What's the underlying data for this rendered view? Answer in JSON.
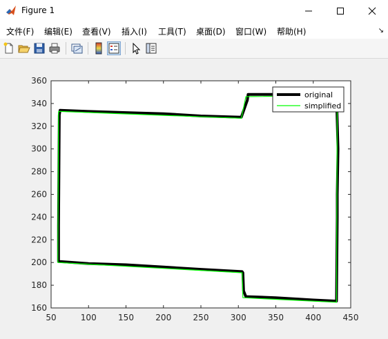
{
  "window": {
    "title": "Figure 1",
    "icons": {
      "app": "matlab-icon",
      "minimize": "minimize-icon",
      "maximize": "maximize-icon",
      "close": "close-icon"
    }
  },
  "menu": {
    "items": [
      "文件(F)",
      "编辑(E)",
      "查看(V)",
      "插入(I)",
      "工具(T)",
      "桌面(D)",
      "窗口(W)",
      "帮助(H)"
    ],
    "overflow_icon": "dock-arrow-icon"
  },
  "toolbar": {
    "buttons": [
      {
        "icon": "new-figure-icon"
      },
      {
        "icon": "open-file-icon"
      },
      {
        "icon": "save-icon"
      },
      {
        "icon": "print-icon"
      },
      {
        "icon": "link-plot-icon"
      },
      {
        "icon": "insert-colorbar-icon"
      },
      {
        "icon": "insert-legend-icon",
        "active": true
      },
      {
        "icon": "edit-plot-icon"
      },
      {
        "icon": "property-editor-icon"
      }
    ]
  },
  "colors": {
    "original": "#000000",
    "simplified": "#00ff00",
    "axes_bg": "#ffffff",
    "figure_bg": "#f0f0f0"
  },
  "chart_data": {
    "type": "line",
    "xlim": [
      50,
      450
    ],
    "ylim": [
      160,
      360
    ],
    "xticks": [
      50,
      100,
      150,
      200,
      250,
      300,
      350,
      400,
      450
    ],
    "yticks": [
      160,
      180,
      200,
      220,
      240,
      260,
      280,
      300,
      320,
      340,
      360
    ],
    "grid": false,
    "legend_position": "top-right",
    "series": [
      {
        "name": "original",
        "color": "#000000",
        "x": [
          61,
          62,
          100,
          150,
          200,
          250,
          300,
          304,
          312,
          313,
          340,
          380,
          431,
          433,
          432,
          432,
          431,
          400,
          350,
          310,
          307,
          306,
          305,
          250,
          200,
          150,
          100,
          60,
          60,
          61
        ],
        "y": [
          330,
          334,
          333,
          332,
          331,
          329,
          328,
          328,
          343,
          348,
          348,
          348,
          347,
          300,
          260,
          240,
          166,
          167,
          169,
          170,
          175,
          191,
          192,
          194,
          196,
          198,
          199,
          201,
          232,
          330
        ]
      },
      {
        "name": "simplified",
        "color": "#00ff00",
        "x": [
          60,
          62,
          304,
          310,
          432,
          431,
          306,
          305,
          59,
          60
        ],
        "y": [
          333,
          333,
          327,
          346,
          347,
          165,
          169,
          191,
          200,
          333
        ]
      }
    ]
  }
}
